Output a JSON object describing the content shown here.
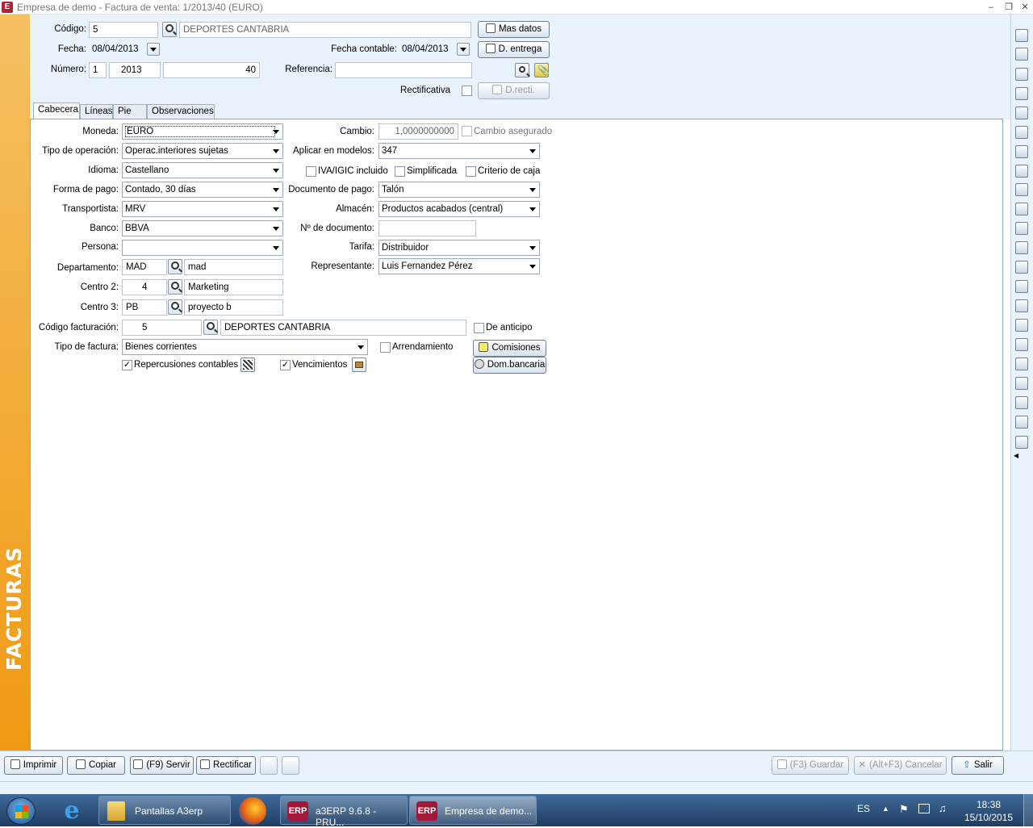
{
  "window": {
    "title": "Empresa de demo - Factura de venta: 1/2013/40 (EURO)",
    "app_icon": "E"
  },
  "side_label": "FACTURAS",
  "header": {
    "codigo_label": "Código:",
    "codigo_value": "5",
    "codigo_name": "DEPORTES CANTABRIA",
    "fecha_label": "Fecha:",
    "fecha_value": "08/04/2013",
    "numero_label": "Número:",
    "numero_serie": "1",
    "numero_year": "2013",
    "numero_value": "40",
    "fecha_contable_label": "Fecha contable:",
    "fecha_contable_value": "08/04/2013",
    "referencia_label": "Referencia:",
    "referencia_value": "",
    "rectificativa_label": "Rectificativa",
    "mas_datos_btn": "Mas datos",
    "d_entrega_btn": "D. entrega",
    "d_recti_btn": "D.recti."
  },
  "tabs": [
    "Cabecera",
    "Líneas",
    "Pie",
    "Observaciones"
  ],
  "form": {
    "moneda_label": "Moneda:",
    "moneda_value": "EURO",
    "cambio_label": "Cambio:",
    "cambio_value": "1,0000000000",
    "cambio_asegurado": "Cambio asegurado",
    "tipo_op_label": "Tipo de operación:",
    "tipo_op_value": "Operac.interiores sujetas",
    "aplicar_label": "Aplicar en modelos:",
    "aplicar_value": "347",
    "idioma_label": "Idioma:",
    "idioma_value": "Castellano",
    "iva_label": "IVA/IGIC incluido",
    "simplificada_label": "Simplificada",
    "criterio_label": "Criterio de caja",
    "forma_pago_label": "Forma de pago:",
    "forma_pago_value": "Contado, 30 días",
    "doc_pago_label": "Documento de pago:",
    "doc_pago_value": "Talón",
    "transportista_label": "Transportista:",
    "transportista_value": "MRV",
    "almacen_label": "Almacén:",
    "almacen_value": "Productos acabados (central)",
    "banco_label": "Banco:",
    "banco_value": "BBVA",
    "n_documento_label": "Nº de documento:",
    "n_documento_value": "",
    "persona_label": "Persona:",
    "persona_value": "",
    "tarifa_label": "Tarifa:",
    "tarifa_value": "Distribuidor",
    "departamento_label": "Departamento:",
    "departamento_code": "MAD",
    "departamento_name": "mad",
    "representante_label": "Representante:",
    "representante_value": "Luis Fernandez Pérez",
    "centro2_label": "Centro 2:",
    "centro2_code": "4",
    "centro2_name": "Marketing",
    "centro3_label": "Centro 3:",
    "centro3_code": "PB",
    "centro3_name": "proyecto b",
    "cod_fact_label": "Código facturación:",
    "cod_fact_code": "5",
    "cod_fact_name": "DEPORTES CANTABRIA",
    "anticipo_label": "De anticipo",
    "tipo_factura_label": "Tipo de factura:",
    "tipo_factura_value": "Bienes corrientes",
    "arrendamiento_label": "Arrendamiento",
    "comisiones_btn": "Comisiones",
    "dom_bancaria_btn": "Dom.bancaria",
    "repercusiones_label": "Repercusiones contables",
    "vencimientos_label": "Vencimientos"
  },
  "bottom": {
    "imprimir": "Imprimir",
    "copiar": "Copiar",
    "servir": "(F9) Servir",
    "rectificar": "Rectificar",
    "guardar": "(F3) Guardar",
    "cancelar": "(Alt+F3) Cancelar",
    "salir": "Salir"
  },
  "taskbar": {
    "folder_label": "Pantallas A3erp",
    "erp1_label": "a3ERP 9.6.8 - PRU...",
    "erp2_label": "Empresa de demo...",
    "erp_badge": "ERP",
    "lang": "ES",
    "time": "18:38",
    "date": "15/10/2015"
  }
}
